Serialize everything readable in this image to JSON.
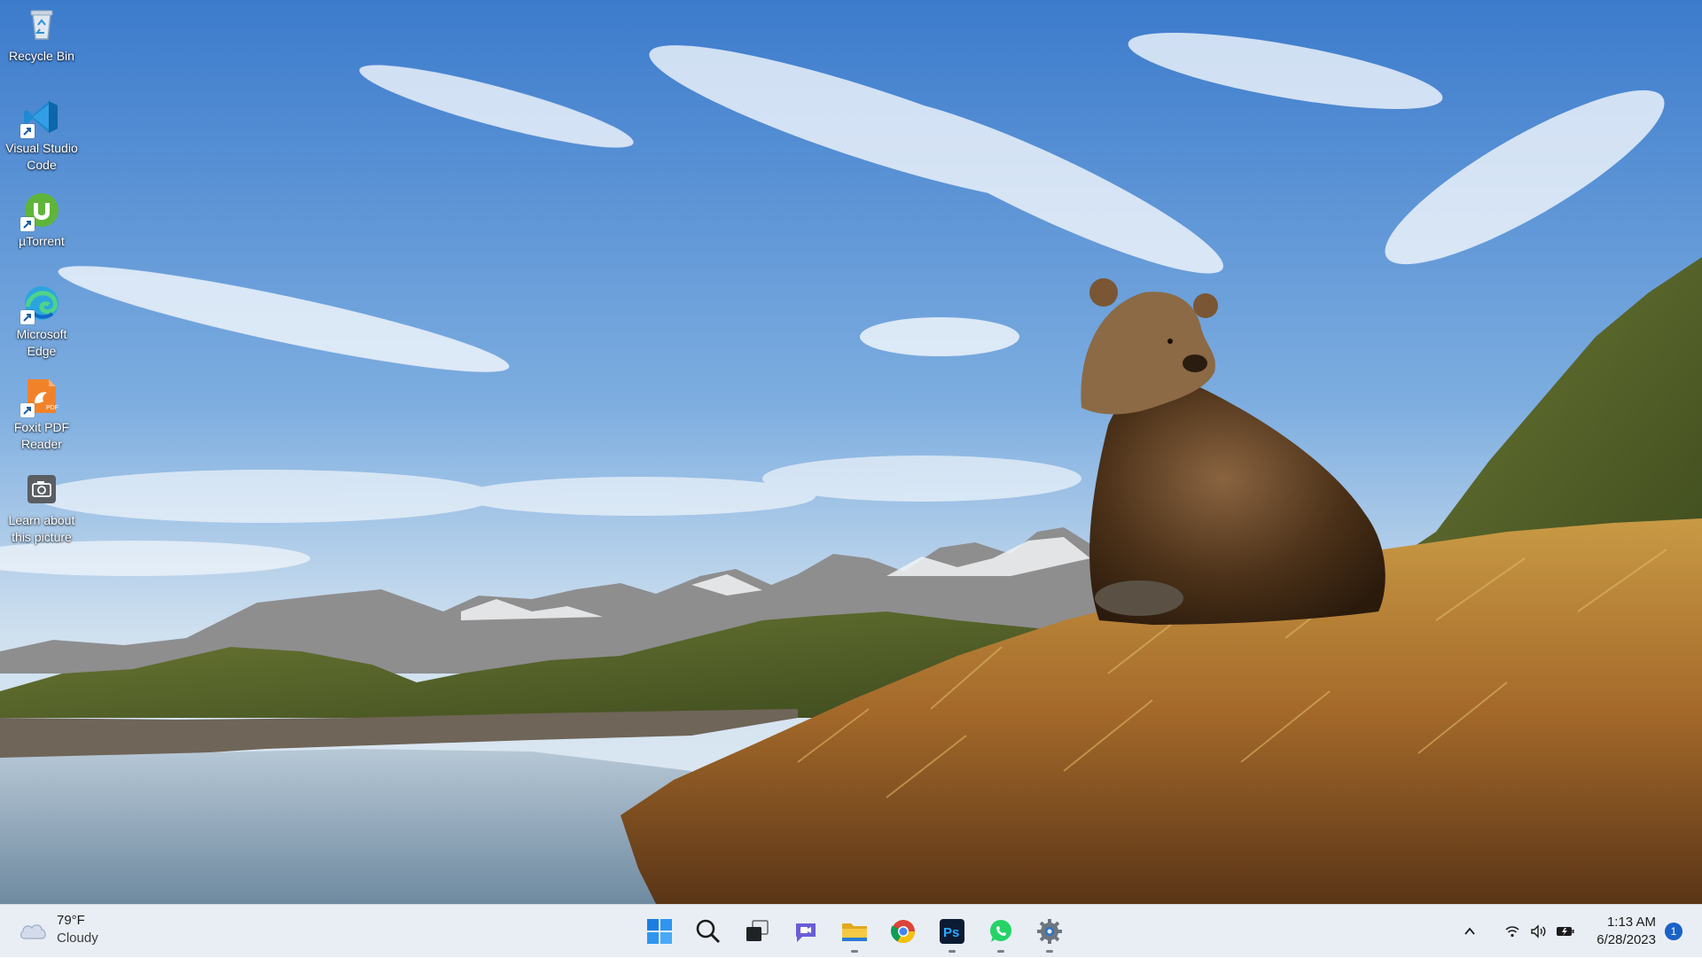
{
  "desktop": {
    "icons": [
      {
        "label": "Recycle Bin"
      },
      {
        "label": "Visual Studio Code"
      },
      {
        "label": "µTorrent"
      },
      {
        "label": "Microsoft Edge"
      },
      {
        "label": "Foxit PDF Reader"
      },
      {
        "label": "Learn about this picture"
      }
    ]
  },
  "taskbar": {
    "weather": {
      "temp": "79°F",
      "condition": "Cloudy",
      "icon": "cloud-icon"
    },
    "apps": [
      {
        "name": "Start",
        "icon": "windows-logo-icon"
      },
      {
        "name": "Search",
        "icon": "search-icon"
      },
      {
        "name": "Task View",
        "icon": "task-view-icon"
      },
      {
        "name": "Chat",
        "icon": "teams-chat-icon"
      },
      {
        "name": "File Explorer",
        "icon": "folder-icon"
      },
      {
        "name": "Google Chrome",
        "icon": "chrome-icon"
      },
      {
        "name": "Photoshop",
        "icon": "photoshop-icon",
        "label": "Ps"
      },
      {
        "name": "WhatsApp",
        "icon": "whatsapp-icon"
      },
      {
        "name": "Settings",
        "icon": "gear-icon"
      }
    ],
    "tray": {
      "time": "1:13 AM",
      "date": "6/28/2023",
      "notification_count": "1"
    }
  },
  "colors": {
    "sky_top": "#3f7fd0",
    "sky_bottom": "#dce9f3",
    "taskbar_bg": "#e9eef4",
    "accent": "#1a62c8"
  }
}
